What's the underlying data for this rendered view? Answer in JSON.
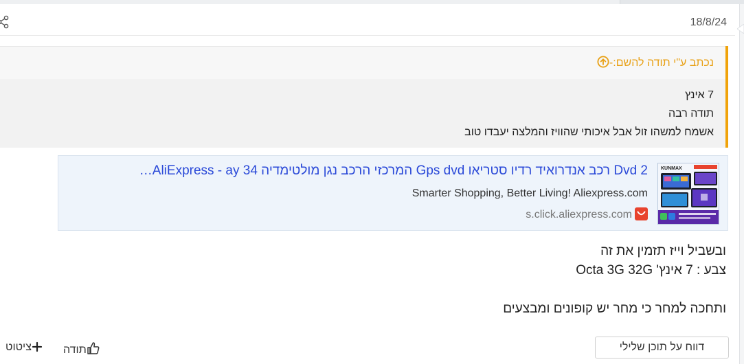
{
  "post": {
    "date": "18/8/24"
  },
  "quote": {
    "author_line": "נכתב ע\"י תודה להשם:-",
    "lines": [
      "7 אינץ",
      "תודה רבה",
      "אשמח למשהו זול אבל איכותי שהוויז והמלצה יעבדו טוב"
    ]
  },
  "link_card": {
    "title": "2 Dvd רכב אנדרואיד רדיו סטריאו Gps dvd המרכזי הרכב נגן מולטימדיה 34 AliExpress - ay…",
    "description": "Smarter Shopping, Better Living! Aliexpress.com",
    "host": "s.click.aliexpress.com",
    "thumb_brand": "KUNMAX"
  },
  "body": {
    "lines": [
      "ובשביל וייז תזמין את זה",
      "צבע : 7 אינץ' Octa 3G 32G",
      "",
      "ותחכה למחר כי מחר יש קופונים ומבצעים"
    ]
  },
  "actions": {
    "report_label": "דווח על תוכן שלילי",
    "like_label": "תודה",
    "quote_label": "ציטוט"
  },
  "colors": {
    "accent_orange": "#f0a30a",
    "link_blue": "#2a49d8",
    "card_bg": "#eef4fb",
    "ali_red": "#e8432e"
  },
  "icons": [
    "share-icon",
    "arrow-up-circle-icon",
    "aliexpress-icon",
    "thumbs-up-icon",
    "plus-icon"
  ]
}
